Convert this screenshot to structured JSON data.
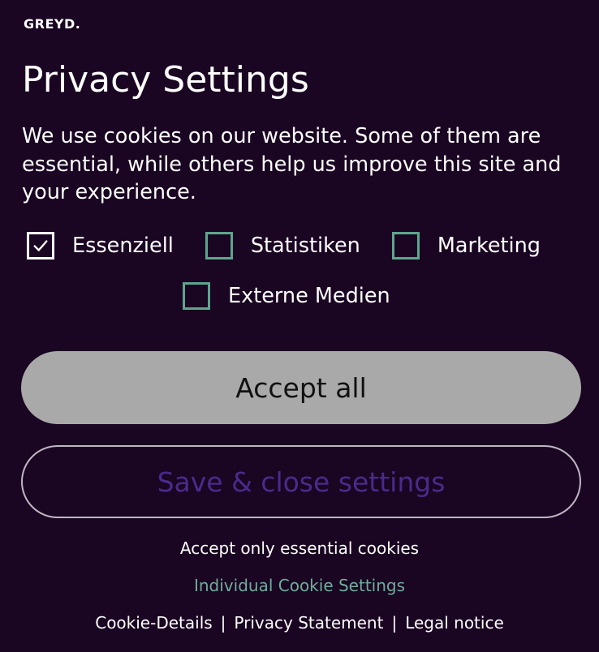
{
  "brand": {
    "logo_text": "GREYD."
  },
  "dialog": {
    "title": "Privacy Settings",
    "intro": "We use cookies on our website. Some of them are essential, while others help us improve this site and your experience."
  },
  "consent_options": [
    {
      "label": "Essenziell",
      "checked": true
    },
    {
      "label": "Statistiken",
      "checked": false
    },
    {
      "label": "Marketing",
      "checked": false
    },
    {
      "label": "Externe Medien",
      "checked": false
    }
  ],
  "buttons": {
    "accept_all": "Accept all",
    "save_close": "Save & close settings"
  },
  "links": {
    "accept_essential": "Accept only essential cookies",
    "individual_settings": "Individual Cookie Settings"
  },
  "footer": {
    "items": [
      "Cookie-Details",
      "Privacy Statement",
      "Legal notice"
    ],
    "separator": "|"
  },
  "colors": {
    "background": "#1a0522",
    "checkbox_border": "#5fa58e",
    "accept_button": "#a9a9a9",
    "save_button_text": "#4b2a8c",
    "individual_link": "#6fae98"
  },
  "icons": {
    "checkmark": "check-icon"
  }
}
